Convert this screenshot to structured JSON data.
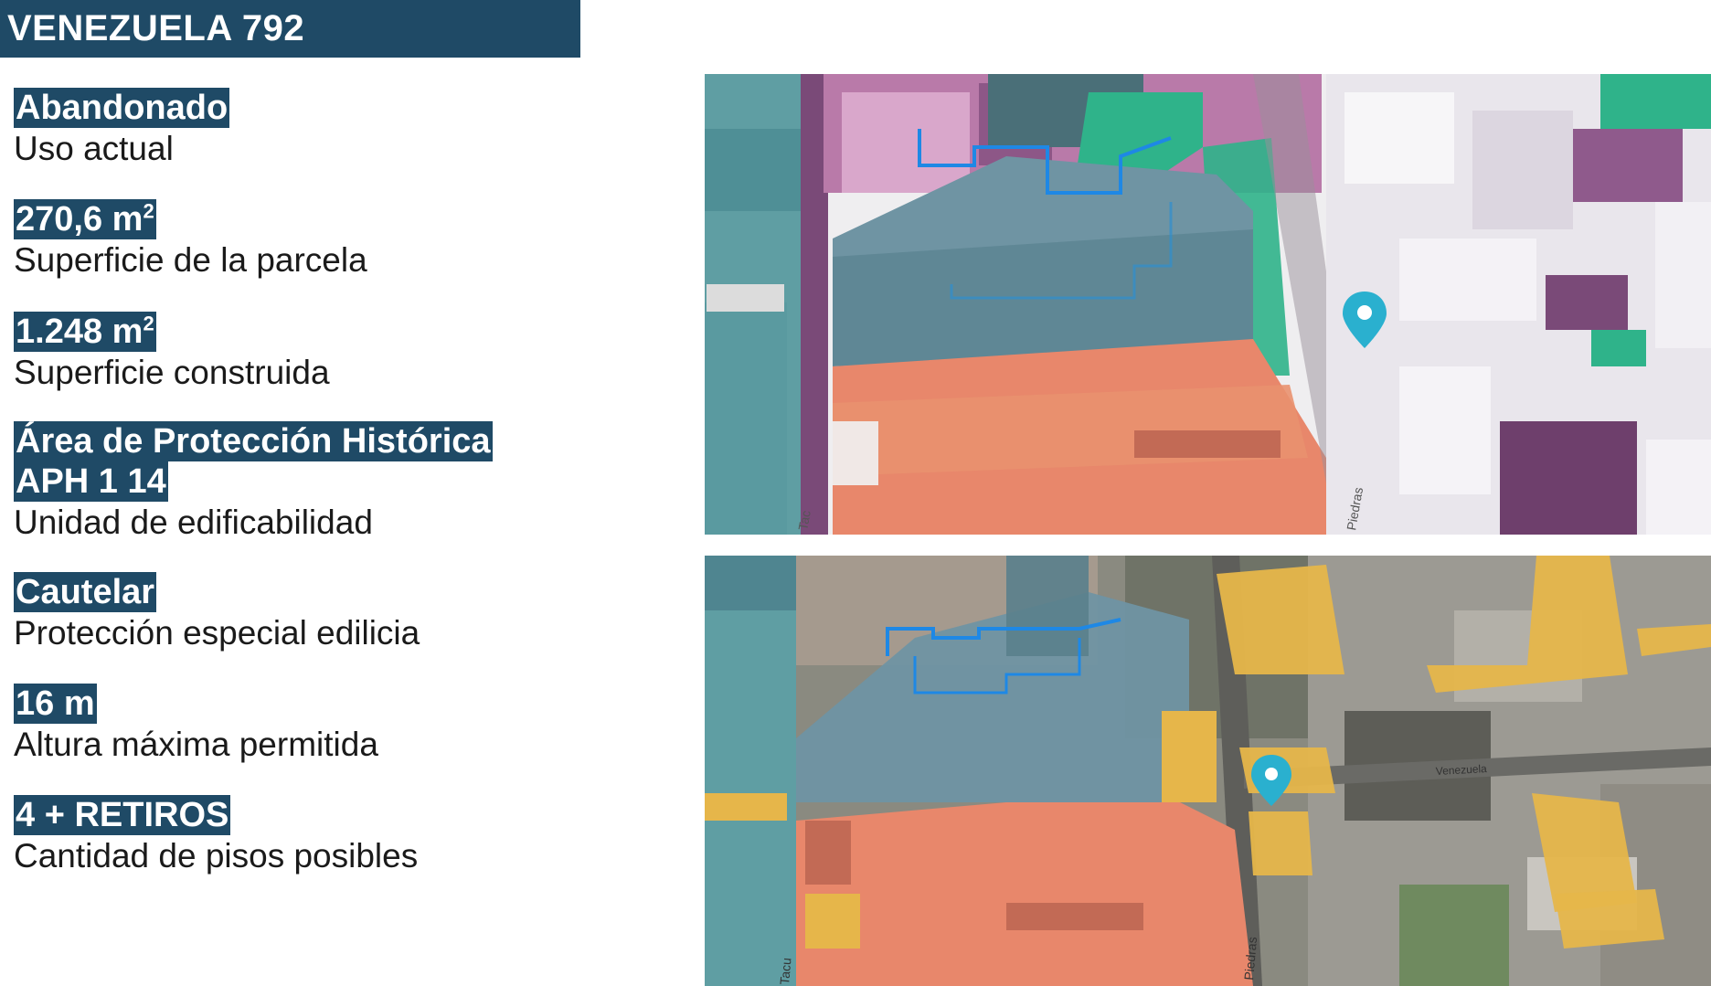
{
  "title": "VENEZUELA 792",
  "facts": [
    {
      "value": "Abandonado",
      "label": "Uso actual"
    },
    {
      "value": "270,6 m",
      "sup": "2",
      "label": "Superficie de la parcela"
    },
    {
      "value": "1.248 m",
      "sup": "2",
      "label": "Superficie construida"
    },
    {
      "value": "Área de Protección Histórica",
      "value2": "APH 1 14",
      "label": "Unidad de edificabilidad"
    },
    {
      "value": "Cautelar",
      "label": "Protección especial edilicia"
    },
    {
      "value": "16 m",
      "label": "Altura máxima permitida"
    },
    {
      "value": "4 +  RETIROS",
      "label": "Cantidad de pisos posibles"
    }
  ],
  "maps": {
    "top": {
      "view": "3d-zoning",
      "street_labels": [
        "Tac",
        "Piedras"
      ]
    },
    "bottom": {
      "view": "satellite-zoning",
      "street_labels": [
        "Tacu",
        "Piedras",
        "Venezuela"
      ]
    }
  },
  "colors": {
    "title_bg": "#1f4a66",
    "highlight_bg": "#1f4a66",
    "zone_salmon": "#e8876b",
    "zone_teal": "#5a9aa0",
    "zone_purple": "#7a4a78",
    "zone_green": "#2fb38a",
    "zone_yellow": "#e6b64a",
    "parcel_outline": "#1e88e5",
    "pin": "#2ab0cf"
  }
}
